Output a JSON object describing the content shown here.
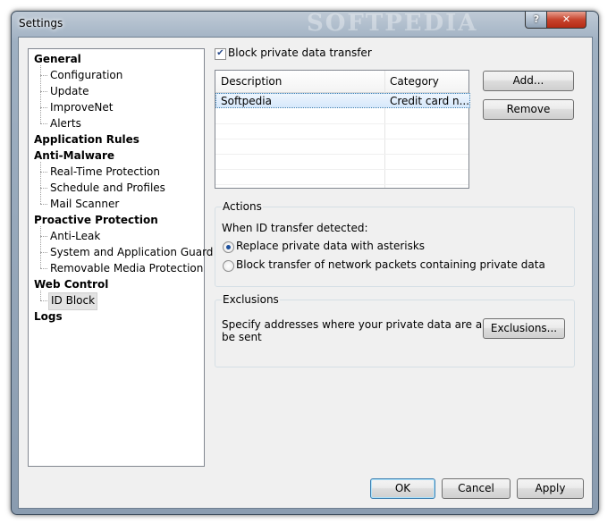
{
  "window": {
    "title": "Settings",
    "watermark": "SOFTPEDIA",
    "help_label": "?",
    "close_label": "✕"
  },
  "tree": [
    {
      "label": "General",
      "level": 0
    },
    {
      "label": "Configuration",
      "level": 1
    },
    {
      "label": "Update",
      "level": 1
    },
    {
      "label": "ImproveNet",
      "level": 1
    },
    {
      "label": "Alerts",
      "level": 1
    },
    {
      "label": "Application Rules",
      "level": 0
    },
    {
      "label": "Anti-Malware",
      "level": 0
    },
    {
      "label": "Real-Time Protection",
      "level": 1
    },
    {
      "label": "Schedule and Profiles",
      "level": 1
    },
    {
      "label": "Mail Scanner",
      "level": 1
    },
    {
      "label": "Proactive Protection",
      "level": 0
    },
    {
      "label": "Anti-Leak",
      "level": 1
    },
    {
      "label": "System and Application Guard",
      "level": 1
    },
    {
      "label": "Removable Media Protection",
      "level": 1
    },
    {
      "label": "Web Control",
      "level": 0
    },
    {
      "label": "ID Block",
      "level": 1,
      "selected": true
    },
    {
      "label": "Logs",
      "level": 0
    }
  ],
  "block_private": {
    "label": "Block private data transfer",
    "checked": true,
    "check_glyph": "✔"
  },
  "list": {
    "columns": [
      "Description",
      "Category"
    ],
    "rows": [
      {
        "description": "Softpedia",
        "category": "Credit card n..."
      }
    ]
  },
  "buttons": {
    "add": "Add...",
    "remove": "Remove",
    "exclusions": "Exclusions...",
    "ok": "OK",
    "cancel": "Cancel",
    "apply": "Apply"
  },
  "actions": {
    "title": "Actions",
    "prompt": "When ID transfer detected:",
    "options": [
      {
        "label": "Replace private data with asterisks",
        "selected": true
      },
      {
        "label": "Block transfer of network packets containing private data",
        "selected": false
      }
    ]
  },
  "exclusions": {
    "title": "Exclusions",
    "text_line1": "Specify addresses where your private data are allowed to",
    "text_line2": "be sent"
  }
}
